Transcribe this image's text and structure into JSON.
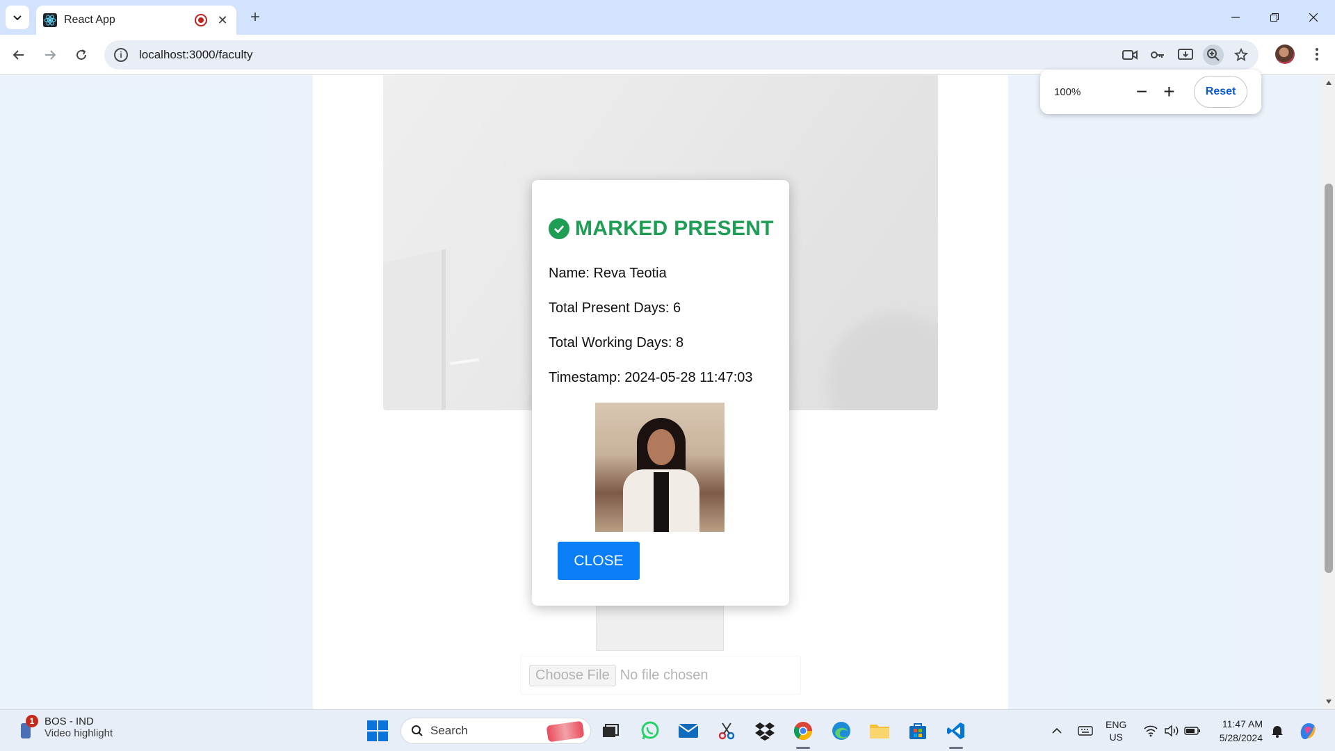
{
  "browser": {
    "tab_title": "React App",
    "url": "localhost:3000/faculty",
    "zoom": {
      "level": "100%",
      "reset_label": "Reset",
      "minus": "−",
      "plus": "+"
    }
  },
  "page": {
    "file_input": {
      "button_label": "Choose File",
      "status": "No file chosen"
    }
  },
  "modal": {
    "heading": "MARKED PRESENT",
    "name_line": "Name: Reva Teotia",
    "present_line": "Total Present Days: 6",
    "working_line": "Total Working Days: 8",
    "timestamp_line": "Timestamp: 2024-05-28 11:47:03",
    "close_label": "CLOSE",
    "accent_color": "#1e9e55",
    "button_color": "#0a7ef7"
  },
  "taskbar": {
    "news": {
      "badge": "1",
      "title": "BOS - IND",
      "subtitle": "Video highlight"
    },
    "search_label": "Search",
    "lang": {
      "line1": "ENG",
      "line2": "US"
    },
    "clock": {
      "time": "11:47 AM",
      "date": "5/28/2024"
    }
  }
}
